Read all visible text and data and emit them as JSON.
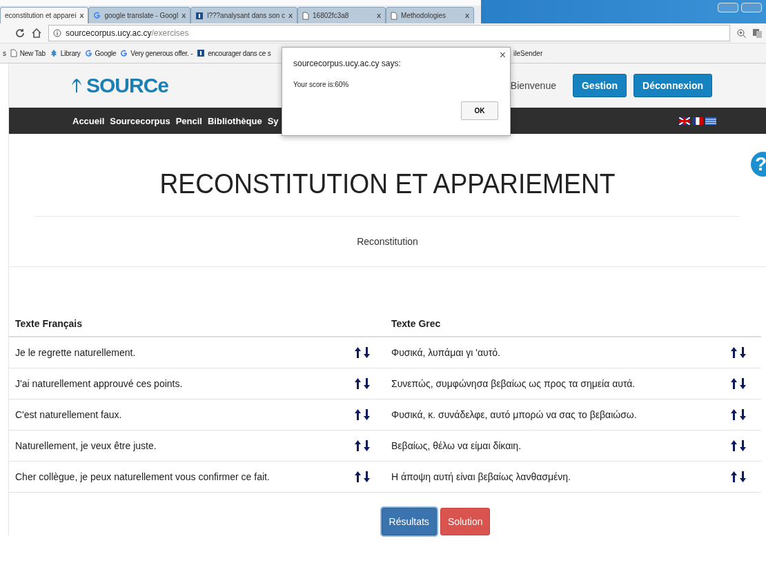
{
  "browser": {
    "tabs": [
      {
        "title": "econstitution et apparei",
        "kind": "plain",
        "close": "X",
        "selected": true
      },
      {
        "title": "google translate - Googl",
        "kind": "search",
        "close": "X",
        "selected": false
      },
      {
        "title": "l???analysant dans son c",
        "kind": "dictionary",
        "close": "X",
        "selected": false
      },
      {
        "title": "16802fc3a8",
        "kind": "document",
        "close": "X",
        "selected": false
      },
      {
        "title": "Methodologies",
        "kind": "document",
        "close": "X",
        "selected": false
      }
    ],
    "address": {
      "host": "sourcecorpus.ucy.ac.cy",
      "path": "/exercises"
    },
    "bookmarks": [
      {
        "label": "s",
        "kind": "plain"
      },
      {
        "label": "New Tab",
        "kind": "document"
      },
      {
        "label": "Library",
        "kind": "library"
      },
      {
        "label": "Google",
        "kind": "search"
      },
      {
        "label": "Very generous offer. -",
        "kind": "search"
      },
      {
        "label": "encourager dans ce s",
        "kind": "dictionary"
      }
    ],
    "bookmarks_right": [
      {
        "label": "ileSender"
      }
    ]
  },
  "site": {
    "logo": "SOURCe",
    "greeting": "Bienvenue",
    "header_buttons": [
      "Gestion",
      "Déconnexion"
    ],
    "nav": [
      "Accueil",
      "Sourcecorpus",
      "Pencil",
      "Bibliothèque",
      "Sy"
    ],
    "help": "?",
    "title": "RECONSTITUTION ET APPARIEMENT",
    "subtitle": "Reconstitution",
    "columns": [
      {
        "heading": "Texte Français",
        "rows": [
          "Je le regrette naturellement.",
          "J'ai naturellement approuvé ces points.",
          "C'est naturellement faux.",
          "Naturellement, je veux être juste.",
          "Cher collègue, je peux naturellement vous confirmer ce fait."
        ]
      },
      {
        "heading": "Texte Grec",
        "rows": [
          "Φυσικά, λυπάμαι γι 'αυτό.",
          "Συνεπώς, συμφώνησα βεβαίως ως προς τα σημεία αυτά.",
          "Φυσικά, κ. συνάδελφε, αυτό μπορώ να σας το βεβαιώσω.",
          "Βεβαίως, θέλω να είμαι δίκαιη.",
          "Η άποψη αυτή είναι βεβαίως λανθασμένη."
        ]
      }
    ],
    "buttons": [
      {
        "label": "Résultats",
        "kind": "primary",
        "focused": true
      },
      {
        "label": "Solution",
        "kind": "danger",
        "focused": false
      }
    ]
  },
  "dialog": {
    "title": "sourcecorpus.ucy.ac.cy says:",
    "message": "Your score is:60%",
    "close": "×",
    "ok": "OK"
  }
}
